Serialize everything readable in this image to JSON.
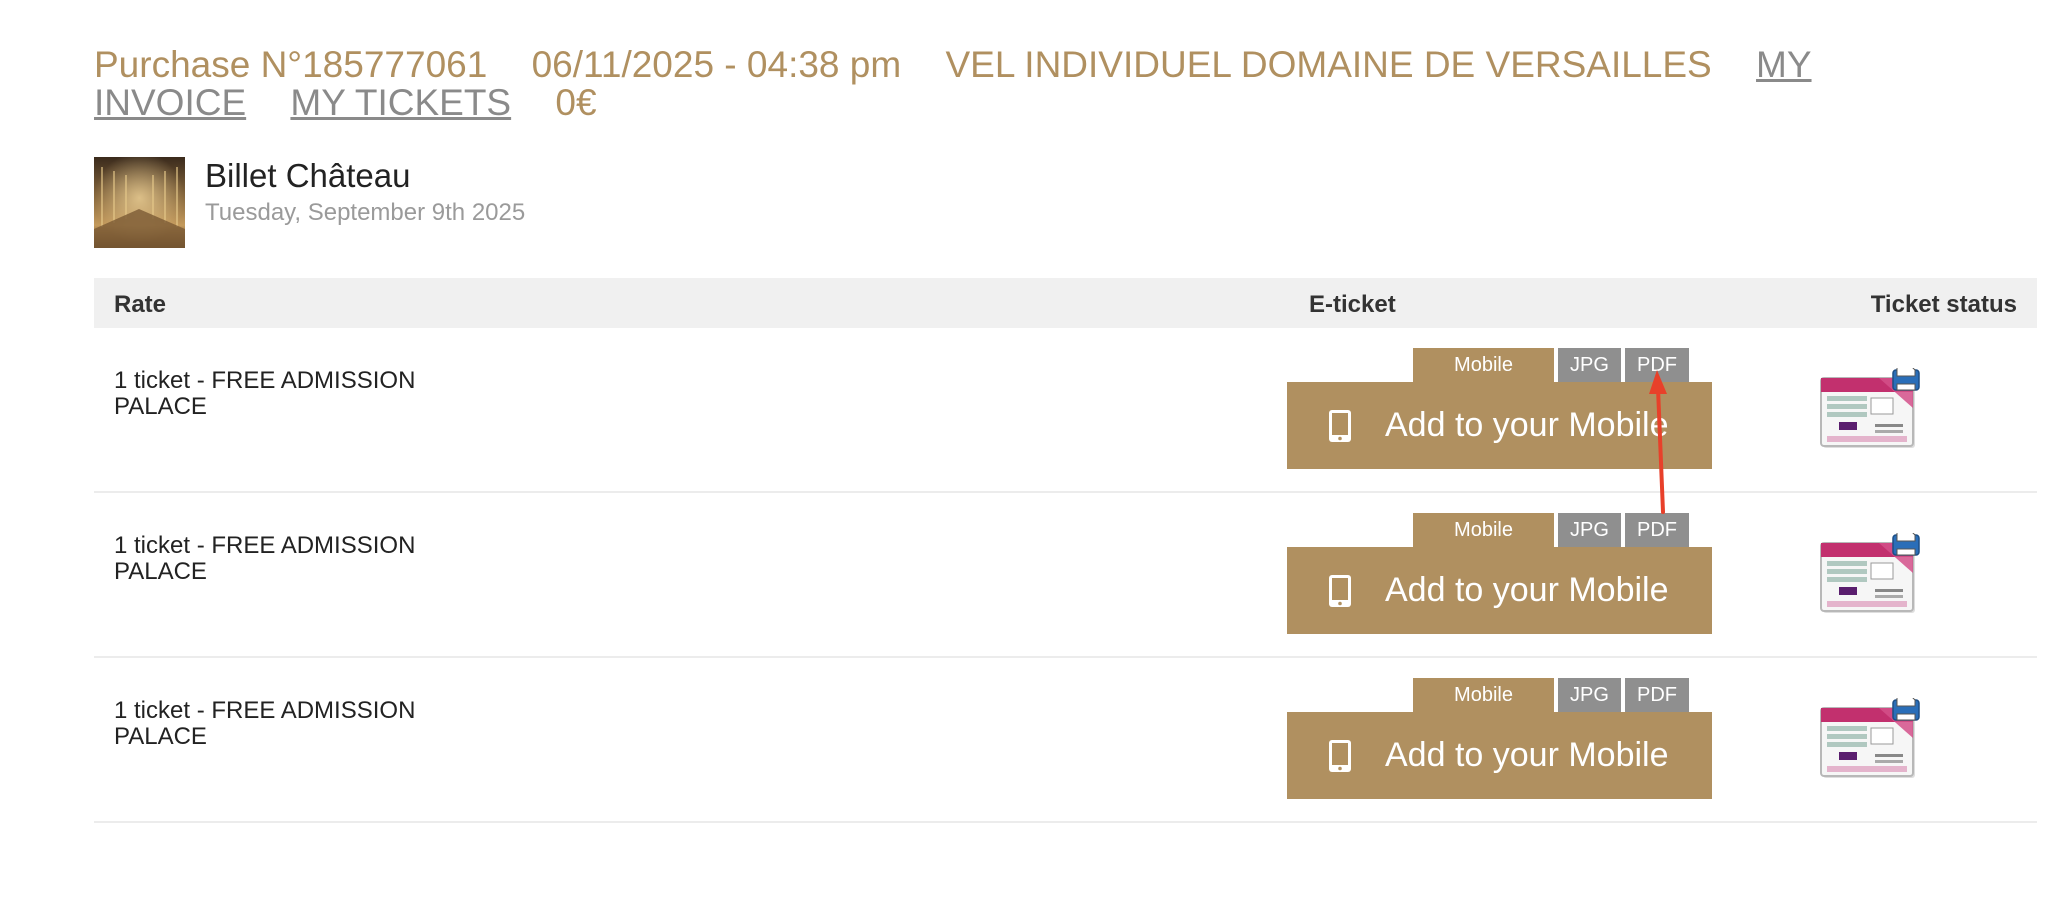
{
  "purchase": {
    "number": "Purchase N°185777061",
    "datetime": "06/11/2025 - 04:38 pm",
    "product_name": "VEL INDIVIDUEL DOMAINE DE VERSAILLES",
    "invoice_link": "MY INVOICE",
    "tickets_link": "MY TICKETS",
    "total": "0€"
  },
  "product": {
    "title": "Billet Château",
    "date": "Tuesday, September 9th 2025",
    "thumbnail_icon": "hall-of-mirrors-photo"
  },
  "table": {
    "headers": {
      "rate": "Rate",
      "eticket": "E-ticket",
      "status": "Ticket status"
    },
    "rows": [
      {
        "rate": "1 ticket - FREE ADMISSION PALACE",
        "tab_mobile": "Mobile",
        "tab_jpg": "JPG",
        "tab_pdf": "PDF",
        "add_label": "Add to your Mobile"
      },
      {
        "rate": "1 ticket - FREE ADMISSION PALACE",
        "tab_mobile": "Mobile",
        "tab_jpg": "JPG",
        "tab_pdf": "PDF",
        "add_label": "Add to your Mobile"
      },
      {
        "rate": "1 ticket - FREE ADMISSION PALACE",
        "tab_mobile": "Mobile",
        "tab_jpg": "JPG",
        "tab_pdf": "PDF",
        "add_label": "Add to your Mobile"
      }
    ]
  },
  "icons": {
    "phone": "mobile-phone-icon",
    "status": "printable-ticket-icon",
    "annotation": "red-arrow"
  },
  "colors": {
    "accent": "#b09060",
    "tab_gray": "#8f8f8f",
    "link_gray": "#8a8a8a",
    "header_bg": "#f0f0f0",
    "annotation_red": "#e8402a"
  }
}
